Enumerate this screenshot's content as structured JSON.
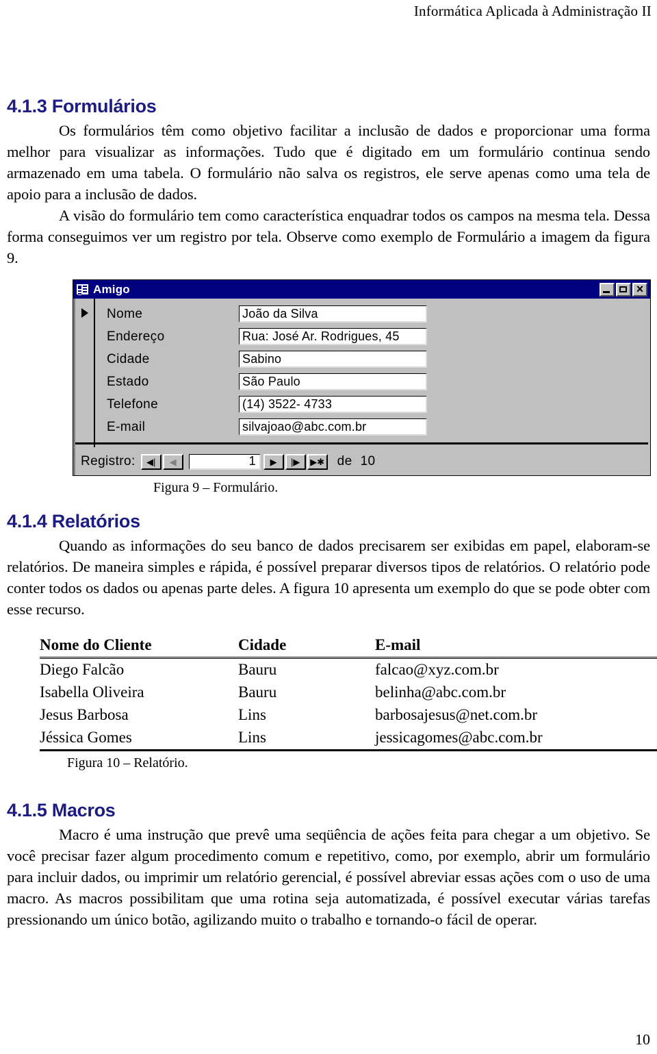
{
  "header": {
    "running_title": "Informática Aplicada à Administração II"
  },
  "sections": [
    {
      "heading": "4.1.3 Formulários",
      "paragraphs": [
        "Os formulários têm como objetivo facilitar a inclusão de dados e proporcionar uma forma melhor para visualizar as informações. Tudo que é digitado em um formulário continua sendo armazenado em uma tabela. O formulário não salva os registros, ele serve apenas como uma tela de apoio para a inclusão de dados.",
        "A visão do formulário tem como característica enquadrar todos os campos na mesma tela. Dessa forma conseguimos ver um registro por tela. Observe como exemplo de Formulário a imagem da figura 9."
      ]
    },
    {
      "heading": "4.1.4 Relatórios",
      "paragraphs": [
        "Quando as informações do seu banco de dados precisarem ser exibidas em papel, elaboram-se relatórios. De maneira simples e rápida, é possível preparar diversos tipos de relatórios. O relatório pode conter todos os dados ou apenas parte deles. A figura 10 apresenta um exemplo do que se pode obter com esse recurso."
      ]
    },
    {
      "heading": "4.1.5 Macros",
      "paragraphs": [
        "Macro é uma instrução que prevê uma seqüência de ações feita para chegar a um objetivo. Se você precisar fazer algum procedimento comum e repetitivo, como, por exemplo, abrir um formulário para incluir dados, ou imprimir um relatório gerencial, é possível abreviar essas ações com o uso de uma macro. As macros possibilitam que uma rotina seja automatizada, é possível executar várias tarefas pressionando um único botão, agilizando muito o trabalho e tornando-o fácil de operar."
      ]
    }
  ],
  "figure_form": {
    "caption": "Figura 9 – Formulário.",
    "window": {
      "title": "Amigo",
      "icon": "access-form-icon",
      "buttons": {
        "minimize": "Minimizar",
        "maximize": "Maximizar",
        "close": "Fechar"
      }
    },
    "fields": [
      {
        "label": "Nome",
        "value": "João da Silva"
      },
      {
        "label": "Endereço",
        "value": "Rua: José Ar. Rodrigues, 45"
      },
      {
        "label": "Cidade",
        "value": "Sabino"
      },
      {
        "label": "Estado",
        "value": "São Paulo"
      },
      {
        "label": "Telefone",
        "value": "(14) 3522- 4733"
      },
      {
        "label": "E-mail",
        "value": "silvajoao@abc.com.br"
      }
    ],
    "navigation": {
      "label": "Registro:",
      "first_glyph": "◀|",
      "prev_glyph": "◀",
      "current_record": "1",
      "next_glyph": "▶",
      "last_glyph": "|▶",
      "new_glyph": "▶✱",
      "of_label": "de",
      "total_records": "10"
    },
    "colors": {
      "titlebar": "#000080",
      "window_face": "#c0c0c0",
      "field_background": "#ffffff"
    }
  },
  "figure_report": {
    "caption": "Figura 10 – Relatório.",
    "columns": [
      "Nome do Cliente",
      "Cidade",
      "E-mail"
    ],
    "rows": [
      [
        "Diego Falcão",
        "Bauru",
        "falcao@xyz.com.br"
      ],
      [
        "Isabella Oliveira",
        "Bauru",
        "belinha@abc.com.br"
      ],
      [
        "Jesus Barbosa",
        "Lins",
        "barbosajesus@net.com.br"
      ],
      [
        "Jéssica Gomes",
        "Lins",
        "jessicagomes@abc.com.br"
      ]
    ]
  },
  "footer": {
    "page_number": "10"
  },
  "theme": {
    "heading_color": "#1c1c82",
    "text_color": "#000000",
    "page_background": "#ffffff"
  }
}
